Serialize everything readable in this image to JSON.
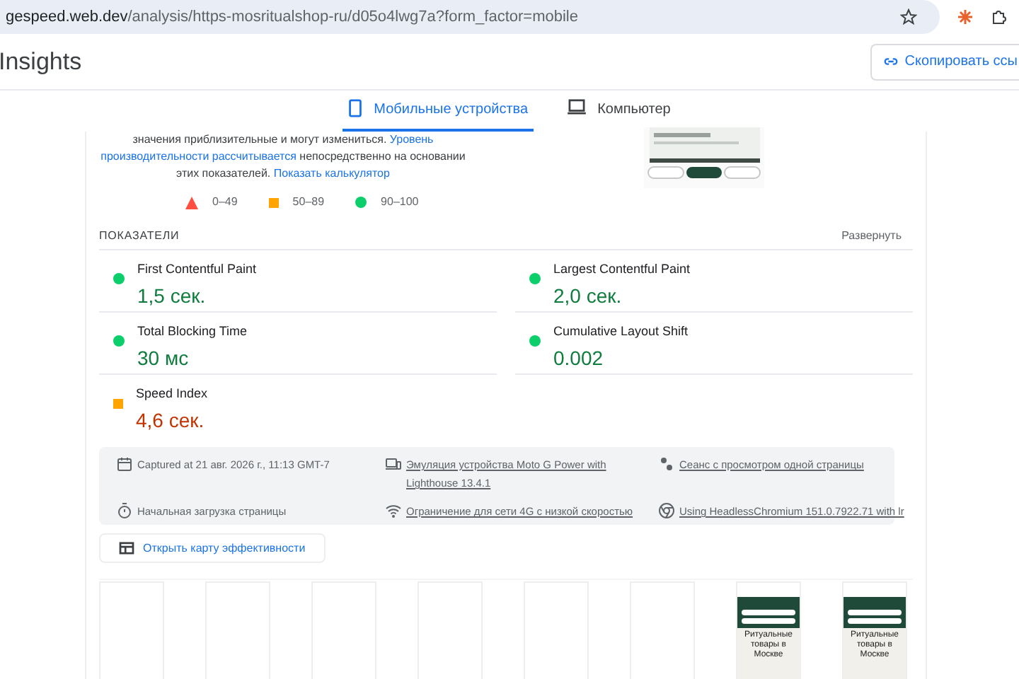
{
  "browser": {
    "url_host": "gespeed.web.dev",
    "url_path": "/analysis/https-mosritualshop-ru/d05o4lwg7a?form_factor=mobile"
  },
  "header": {
    "title": "Insights",
    "copy_button": "Скопировать ссы"
  },
  "tabs": [
    {
      "label": "Мобильные устройства",
      "kind": "mobile",
      "selected": true
    },
    {
      "label": "Компьютер",
      "kind": "desktop",
      "selected": false
    }
  ],
  "intro": {
    "line_1": "значения приблизительные и могут измениться.",
    "link_1a": "Уровень",
    "link_1b": "производительности рассчитывается",
    "line_2": "непосредственно на основании",
    "line_3": "этих показателей.",
    "link_2": "Показать калькулятор"
  },
  "legend": [
    {
      "kind": "fail",
      "label": "0–49"
    },
    {
      "kind": "average",
      "label": "50–89"
    },
    {
      "kind": "pass",
      "label": "90–100"
    }
  ],
  "metrics_header": {
    "title": "ПОКАЗАТЕЛИ",
    "toggle": "Развернуть"
  },
  "metrics": [
    {
      "label": "First Contentful Paint",
      "value": "1,5 сек.",
      "kind": "pass"
    },
    {
      "label": "Largest Contentful Paint",
      "value": "2,0 сек.",
      "kind": "pass"
    },
    {
      "label": "Total Blocking Time",
      "value": "30 мс",
      "kind": "pass"
    },
    {
      "label": "Cumulative Layout Shift",
      "value": "0.002",
      "kind": "pass"
    },
    {
      "label": "Speed Index",
      "value": "4,6 сек.",
      "kind": "average"
    }
  ],
  "run_info": [
    {
      "kind": "calendar",
      "text": "Captured at 21 авг. 2026 г., 11:13 GMT-7",
      "link": false
    },
    {
      "kind": "device",
      "text": "Эмуляция устройства Moto G Power with Lighthouse 13.4.1",
      "link": true
    },
    {
      "kind": "session",
      "text": "Сеанс с просмотром одной страницы",
      "link": true
    },
    {
      "kind": "timer",
      "text": "Начальная загрузка страницы",
      "link": false
    },
    {
      "kind": "wifi",
      "text": "Ограничение для сети 4G с низкой скоростью",
      "link": true
    },
    {
      "kind": "chrome",
      "text": "Using HeadlessChromium 151.0.7922.71 with lr",
      "link": true
    }
  ],
  "treemap_button": "Открыть карту эффективности",
  "filmstrip": [
    {
      "kind": "blank"
    },
    {
      "kind": "blank"
    },
    {
      "kind": "blank"
    },
    {
      "kind": "blank"
    },
    {
      "kind": "blank"
    },
    {
      "kind": "blank"
    },
    {
      "kind": "page",
      "heading": "Ритуальные товары в Москве"
    },
    {
      "kind": "page",
      "heading": "Ритуальные товары в Москве"
    }
  ]
}
